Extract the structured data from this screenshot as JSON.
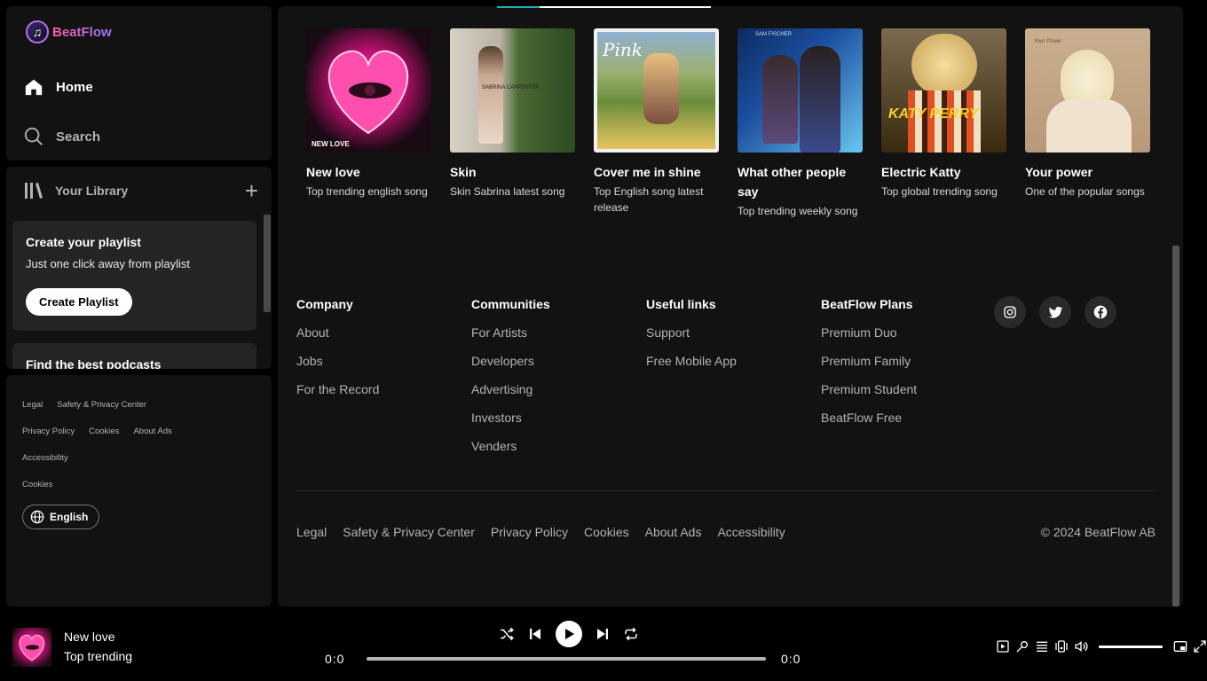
{
  "app": {
    "name": "BeatFlow",
    "logo_icon": "music-note-icon"
  },
  "nav": {
    "home_label": "Home",
    "search_label": "Search"
  },
  "library": {
    "title": "Your Library",
    "create_card": {
      "title": "Create your playlist",
      "subtitle": "Just one click away from playlist",
      "button": "Create Playlist"
    },
    "podcast_card": {
      "title": "Find the best podcasts"
    }
  },
  "sidebar_legal": {
    "row1": [
      "Legal",
      "Safety & Privacy Center"
    ],
    "row2": [
      "Privacy Policy",
      "Cookies",
      "About Ads"
    ],
    "row3": [
      "Accessibility"
    ],
    "row4": [
      "Cookies"
    ],
    "language": "English"
  },
  "songs": [
    {
      "title": "New love",
      "subtitle": "Top trending english song",
      "cover_label": "NEW LOVE",
      "colors": [
        "#1a0a14",
        "#ff3fa4"
      ]
    },
    {
      "title": "Skin",
      "subtitle": "Skin Sabrina latest song",
      "cover_label": "SABRINA CARPENTER",
      "colors": [
        "#c9c4b8",
        "#3f5a2e"
      ]
    },
    {
      "title": "Cover me in shine",
      "subtitle": "Top English song latest release",
      "cover_label": "Pink",
      "colors": [
        "#6a8d3a",
        "#e8c460"
      ]
    },
    {
      "title": "What other people say",
      "subtitle": "Top trending weekly song",
      "cover_label": "SAM FISCHER",
      "colors": [
        "#1c4fa0",
        "#69c6ef"
      ]
    },
    {
      "title": "Electric Katty",
      "subtitle": "Top global trending song",
      "cover_label": "KATY PERRY",
      "colors": [
        "#3a2a10",
        "#e0b840"
      ]
    },
    {
      "title": "Your power",
      "subtitle": "One of the popular songs",
      "cover_label": "Your Power",
      "colors": [
        "#c9b08f",
        "#efe2cf"
      ]
    }
  ],
  "footer": {
    "columns": [
      {
        "title": "Company",
        "links": [
          "About",
          "Jobs",
          "For the Record"
        ]
      },
      {
        "title": "Communities",
        "links": [
          "For Artists",
          "Developers",
          "Advertising",
          "Investors",
          "Venders"
        ]
      },
      {
        "title": "Useful links",
        "links": [
          "Support",
          "Free Mobile App"
        ]
      },
      {
        "title": "BeatFlow Plans",
        "links": [
          "Premium Duo",
          "Premium Family",
          "Premium Student",
          "BeatFlow Free"
        ]
      }
    ],
    "socials": [
      "instagram-icon",
      "twitter-icon",
      "facebook-icon"
    ],
    "bottom_links": [
      "Legal",
      "Safety & Privacy Center",
      "Privacy Policy",
      "Cookies",
      "About Ads",
      "Accessibility"
    ],
    "copyright": "© 2024 BeatFlow AB"
  },
  "player": {
    "title": "New love",
    "subtitle": "Top trending",
    "time_current": "0:0",
    "time_total": "0:0",
    "progress": 0,
    "volume": 1.0
  }
}
